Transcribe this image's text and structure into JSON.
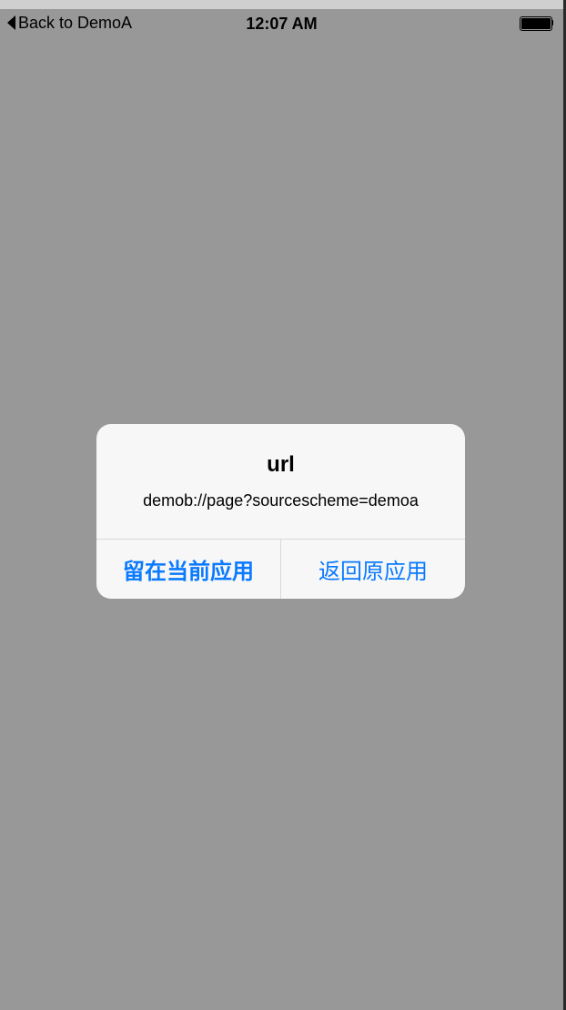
{
  "status_bar": {
    "back_label": "Back to DemoA",
    "time": "12:07 AM",
    "battery_level": 1.0
  },
  "alert": {
    "title": "url",
    "message": "demob://page?sourcescheme=demoa",
    "buttons": [
      {
        "label": "留在当前应用"
      },
      {
        "label": "返回原应用"
      }
    ]
  },
  "colors": {
    "background": "#989898",
    "alert_background": "#f7f7f7",
    "button_text": "#0a7aff"
  },
  "icons": {
    "back": "back-arrow-icon",
    "battery": "battery-icon"
  }
}
